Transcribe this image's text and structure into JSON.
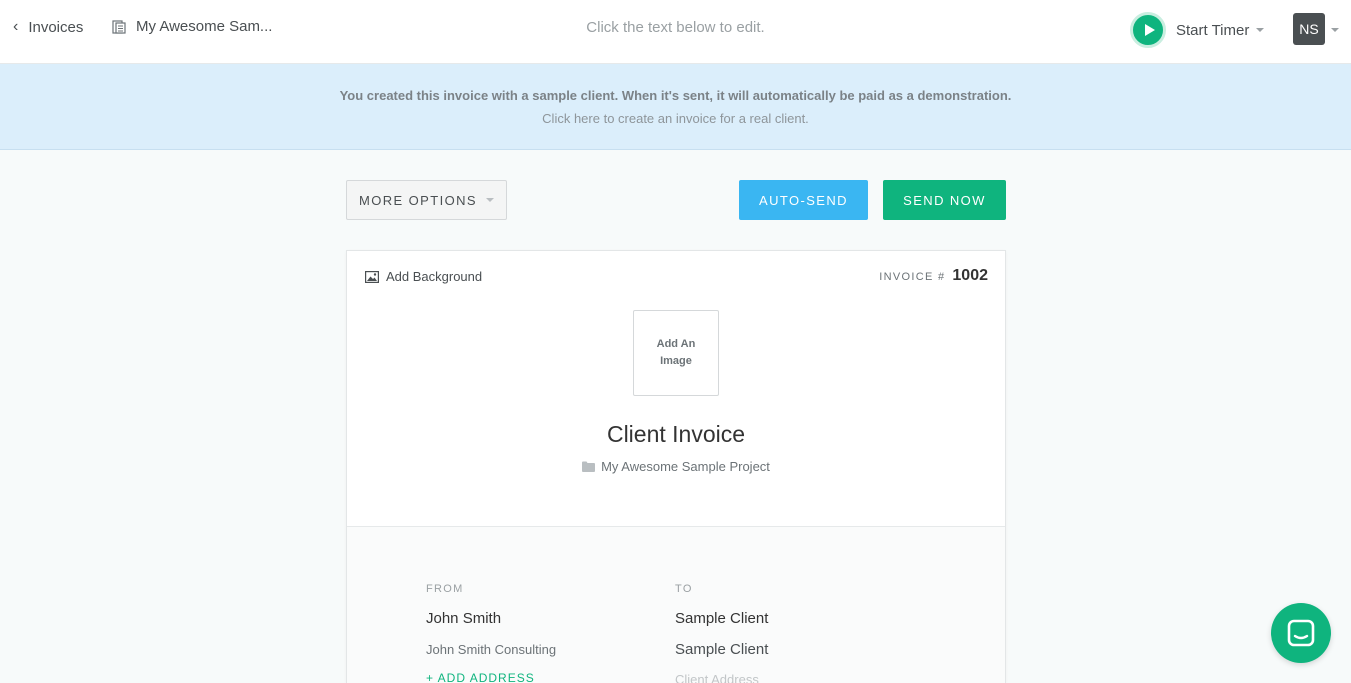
{
  "topbar": {
    "back_label": "Invoices",
    "breadcrumb": "My Awesome Sam...",
    "hint": "Click the text below to edit.",
    "timer_label": "Start Timer",
    "avatar_initials": "NS"
  },
  "banner": {
    "message": "You created this invoice with a sample client. When it's sent, it will automatically be paid as a demonstration.",
    "link": "Click here to create an invoice for a real client."
  },
  "actions": {
    "more_options": "MORE OPTIONS",
    "auto_send": "AUTO-SEND",
    "send_now": "SEND NOW"
  },
  "invoice": {
    "add_background": "Add Background",
    "number_label": "INVOICE #",
    "number": "1002",
    "add_image": "Add An Image",
    "title": "Client Invoice",
    "project": "My Awesome Sample Project",
    "from": {
      "heading": "FROM",
      "name": "John Smith",
      "company": "John Smith Consulting",
      "add_address": "+ ADD ADDRESS"
    },
    "to": {
      "heading": "TO",
      "name": "Sample Client",
      "company": "Sample Client",
      "address_placeholder": "Client Address"
    }
  },
  "colors": {
    "accent_green": "#0fb47e",
    "accent_blue": "#3ab6f2",
    "banner_bg": "#dbeefb"
  },
  "icons": [
    "chevron-left-icon",
    "document-icon",
    "play-icon",
    "image-icon",
    "folder-icon",
    "chat-icon"
  ]
}
